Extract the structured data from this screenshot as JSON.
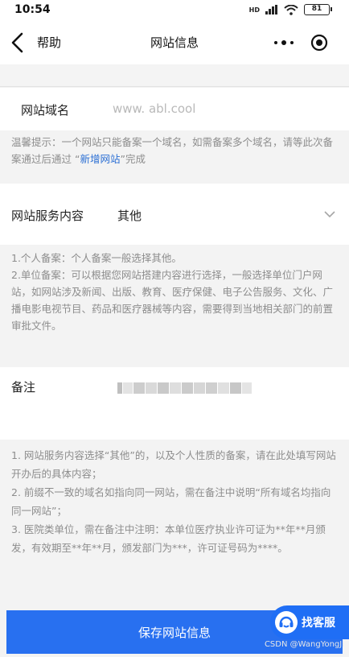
{
  "status_bar": {
    "time": "10:54",
    "network": "HD",
    "battery": "81"
  },
  "nav": {
    "back_label": "帮助",
    "title": "网站信息"
  },
  "domain": {
    "label": "网站域名",
    "placeholder": "www. abl.cool"
  },
  "tip": {
    "prefix": "温馨提示：一个网站只能备案一个域名，如需备案多个域名，请等此次备案通过后通过 “",
    "link": "新增网站",
    "suffix": "”完成"
  },
  "service": {
    "label": "网站服务内容",
    "value": "其他",
    "description": [
      "1.个人备案：个人备案一般选择其他。",
      "2.单位备案：可以根据您网站搭建内容进行选择，一般选择单位门户网站，如网站涉及新闻、出版、教育、医疗保健、电子公告服务、文化、广播电影电视节目、药品和医疗器械等内容，需要得到当地相关部门的前置审批文件。"
    ]
  },
  "remark": {
    "label": "备注",
    "description": [
      "1. 网站服务内容选择“其他”的，以及个人性质的备案，请在此处填写网站开办后的具体内容；",
      "2. 前缀不一致的域名如指向同一网站，需在备注中说明“所有域名均指向同一网站”；",
      "3. 医院类单位，需在备注中注明：本单位医疗执业许可证为**年**月颁发，有效期至**年**月，颁发部门为***，许可证号码为****。"
    ]
  },
  "actions": {
    "save_label": "保存网站信息",
    "kefu_label": "找客服"
  },
  "watermark": "CSDN @WangYongJi",
  "colors": {
    "primary": "#2870f0",
    "link": "#2b6fd4",
    "hint_text": "#8d8d8d"
  }
}
